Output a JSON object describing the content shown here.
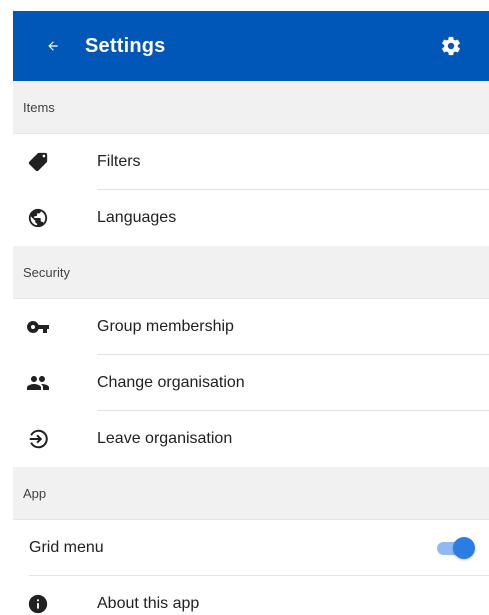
{
  "app_bar": {
    "title": "Settings",
    "back_icon": "arrow-left-icon",
    "settings_icon": "gear-icon",
    "color": "#0057b8"
  },
  "sections": [
    {
      "header": "Items",
      "items": [
        {
          "label": "Filters",
          "icon": "tag-icon"
        },
        {
          "label": "Languages",
          "icon": "globe-icon"
        }
      ]
    },
    {
      "header": "Security",
      "items": [
        {
          "label": "Group membership",
          "icon": "key-icon"
        },
        {
          "label": "Change organisation",
          "icon": "people-icon"
        },
        {
          "label": "Leave organisation",
          "icon": "logout-circle-icon"
        }
      ]
    },
    {
      "header": "App",
      "items": [
        {
          "label": "Grid menu",
          "toggle": true,
          "toggle_on": true,
          "toggle_color": "#2a7de1"
        },
        {
          "label": "About this app",
          "icon": "info-icon"
        }
      ]
    }
  ]
}
